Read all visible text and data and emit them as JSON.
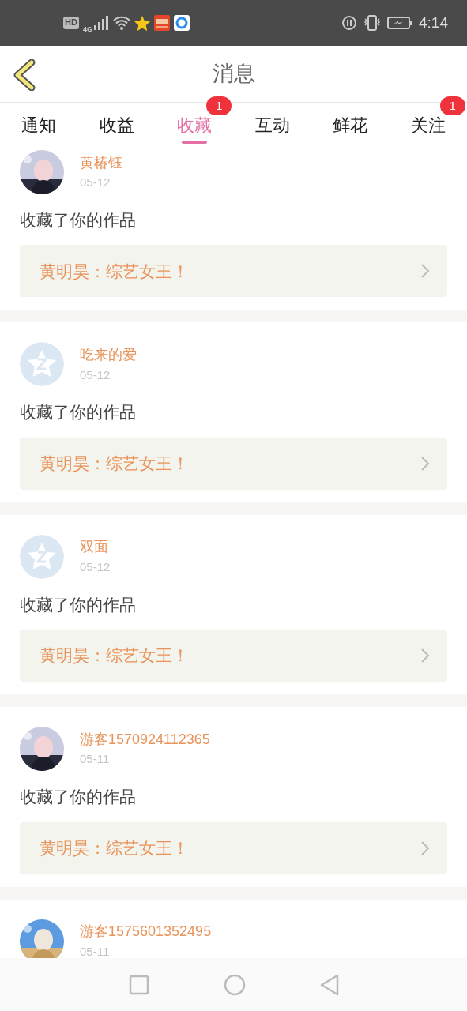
{
  "status_bar": {
    "hd": "HD",
    "network": "4G",
    "time": "4:14"
  },
  "header": {
    "title": "消息"
  },
  "tabs": [
    {
      "label": "通知",
      "selected": false
    },
    {
      "label": "收益",
      "selected": false
    },
    {
      "label": "收藏",
      "selected": true,
      "badge": "1"
    },
    {
      "label": "互动",
      "selected": false
    },
    {
      "label": "鲜花",
      "selected": false
    },
    {
      "label": "关注",
      "selected": false,
      "badge": "1"
    }
  ],
  "messages": [
    {
      "name": "黄椿钰",
      "date": "05-12",
      "text": "收藏了你的作品",
      "work": "黄明昊：综艺女王！"
    },
    {
      "avatar": {
        "kind": "default"
      },
      "name": "吃来的爱",
      "date": "05-12",
      "text": "收藏了你的作品",
      "work": "黄明昊：综艺女王！"
    },
    {
      "avatar": {
        "kind": "default"
      },
      "name": "双面",
      "date": "05-12",
      "text": "收藏了你的作品",
      "work": "黄明昊：综艺女王！"
    },
    {
      "name": "游客1570924112365",
      "date": "05-11",
      "text": "收藏了你的作品",
      "work": "黄明昊：综艺女王！"
    },
    {
      "name": "游客1575601352495",
      "date": "05-11"
    }
  ]
}
